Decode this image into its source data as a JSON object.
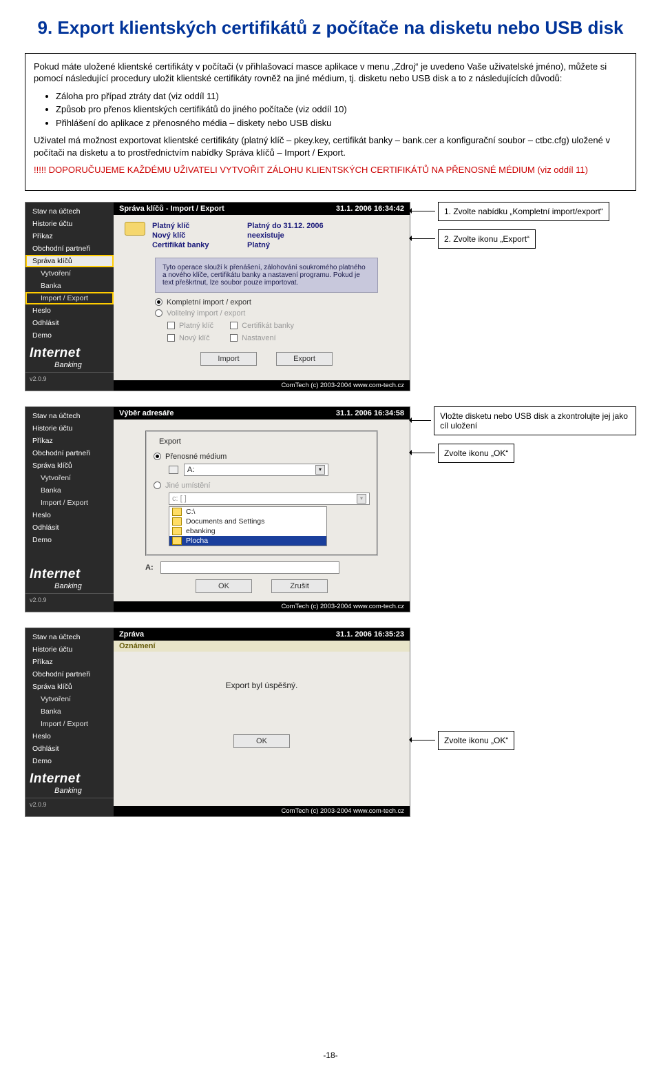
{
  "section": {
    "heading": "9. Export klientských certifikátů z počítače na disketu nebo USB disk"
  },
  "intro": {
    "p1": "Pokud máte uložené klientské certifikáty v počítači (v přihlašovací masce aplikace v menu „Zdroj“ je uvedeno Vaše uživatelské jméno), můžete si pomocí následující procedury uložit klientské certifikáty rovněž na jiné médium, tj. disketu nebo USB disk a to z následujících důvodů:",
    "b1": "Záloha pro případ ztráty dat (viz oddíl 11)",
    "b2": "Způsob pro přenos klientských certifikátů do jiného počítače (viz oddíl 10)",
    "b3": "Přihlášení do aplikace z přenosného média – diskety nebo USB disku",
    "p2": "Uživatel má možnost exportovat klientské certifikáty (platný klíč – pkey.key, certifikát banky – bank.cer a konfigurační soubor – ctbc.cfg) uložené v počítači na disketu a to prostřednictvím nabídky Správa klíčů – Import / Export.",
    "warn": "!!!!! DOPORUČUJEME KAŽDÉMU UŽIVATELI VYTVOŘIT ZÁLOHU KLIENTSKÝCH CERTIFIKÁTŮ NA PŘENOSNÉ MÉDIUM (viz oddíl 11)"
  },
  "sidebar": {
    "items": [
      "Stav na účtech",
      "Historie účtu",
      "Příkaz",
      "Obchodní partneři",
      "Správa klíčů",
      "Vytvoření",
      "Banka",
      "Import / Export",
      "Heslo",
      "Odhlásit",
      "Demo"
    ],
    "logo_big": "Internet",
    "logo_small": "Banking",
    "version": "v2.0.9"
  },
  "shot1": {
    "title": "Správa klíčů - Import / Export",
    "time": "31.1. 2006  16:34:42",
    "status": {
      "k1": "Platný klíč",
      "v1": "Platný do 31.12. 2006",
      "k2": "Nový klíč",
      "v2": "neexistuje",
      "k3": "Certifikát banky",
      "v3": "Platný"
    },
    "info": "Tyto operace slouží k přenášení, zálohování soukromého platného a nového klíče, certifikátu banky a nastavení programu. Pokud je text přeškrtnut, lze soubor pouze importovat.",
    "r1": "Kompletní import / export",
    "r2": "Volitelný import / export",
    "c1": "Platný klíč",
    "c2": "Certifikát banky",
    "c3": "Nový klíč",
    "c4": "Nastavení",
    "btn_import": "Import",
    "btn_export": "Export",
    "footer": "ComTech (c) 2003-2004 www.com-tech.cz"
  },
  "callouts": {
    "c1": "1. Zvolte nabídku „Kompletní import/export“",
    "c2": "2. Zvolte ikonu „Export“",
    "c3": "Vložte disketu nebo USB disk a zkontrolujte jej jako cíl uložení",
    "c4": "Zvolte ikonu „OK“",
    "c5": "Zvolte ikonu „OK“"
  },
  "shot2": {
    "title": "Výběr adresáře",
    "time": "31.1. 2006  16:34:58",
    "legend": "Export",
    "r1": "Přenosné médium",
    "drive": "A:",
    "r2": "Jiné umístění",
    "path": "c: [ ]",
    "d1": "C:\\",
    "d2": "Documents and Settings",
    "d3": "ebanking",
    "d4": "Plocha",
    "out_label": "A:",
    "btn_ok": "OK",
    "btn_cancel": "Zrušit",
    "footer": "ComTech (c) 2003-2004 www.com-tech.cz"
  },
  "shot3": {
    "title": "Zpráva",
    "time": "31.1. 2006  16:35:23",
    "panel": "Oznámení",
    "msg": "Export byl úspěšný.",
    "btn_ok": "OK",
    "footer": "ComTech (c) 2003-2004 www.com-tech.cz"
  },
  "pagefoot": "-18-"
}
